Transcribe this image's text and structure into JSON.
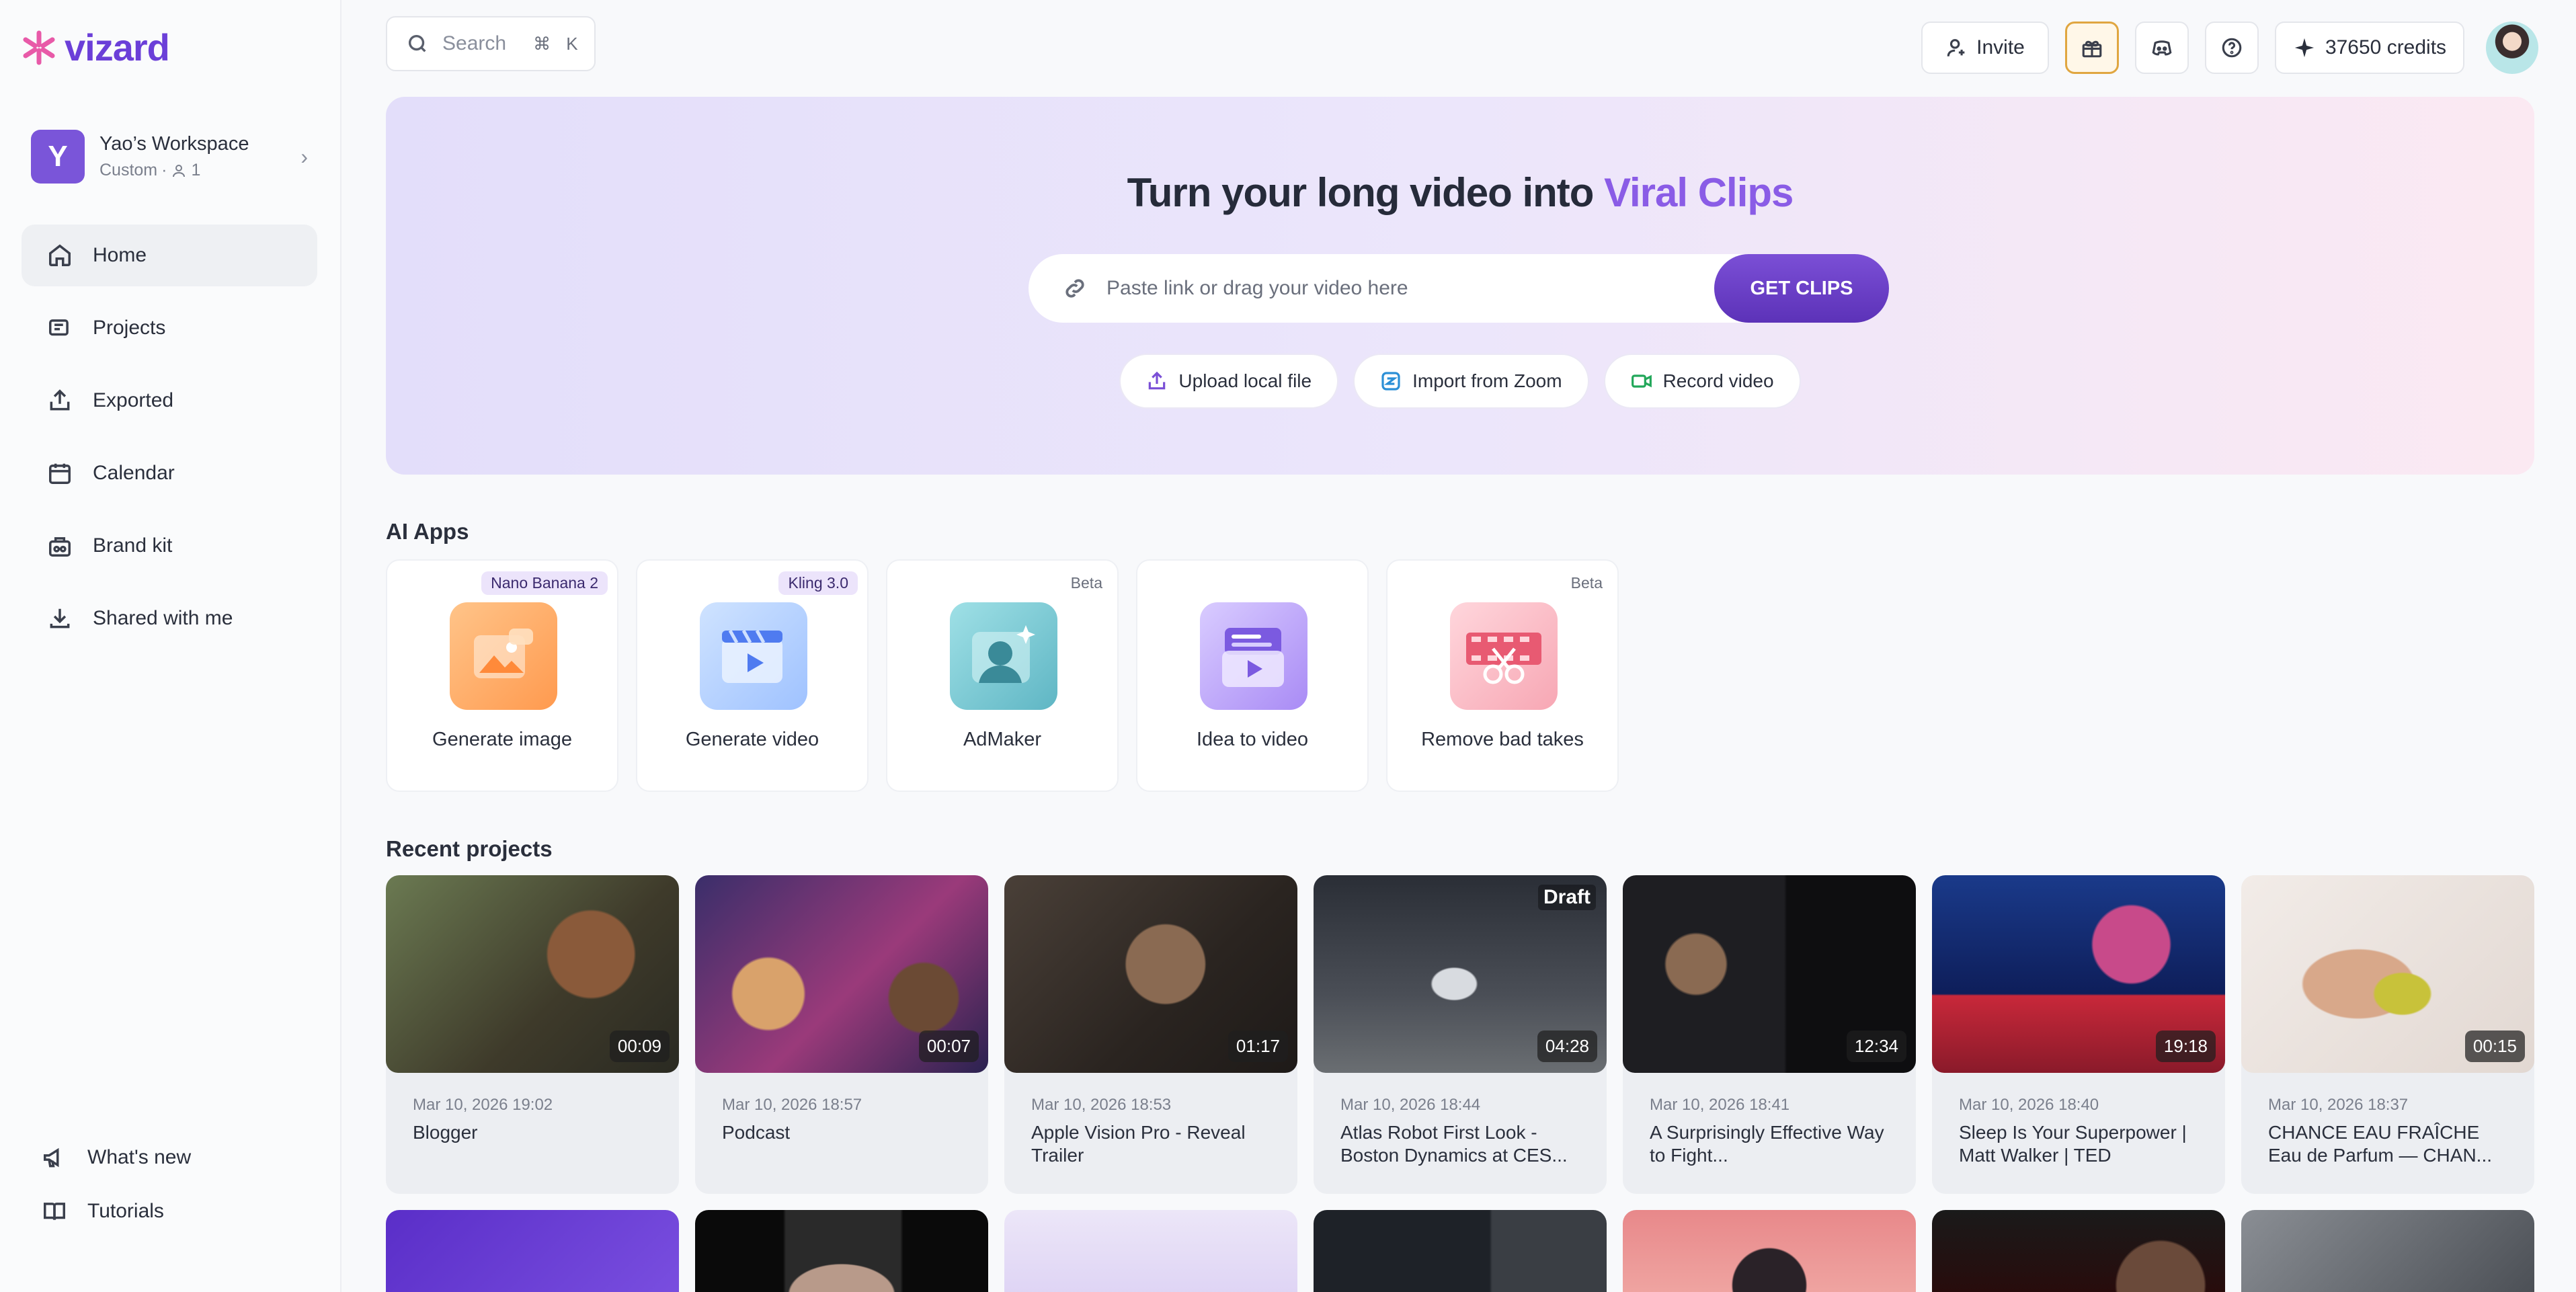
{
  "app": {
    "logo_text": "vizard"
  },
  "workspace": {
    "avatar_letter": "Y",
    "name": "Yao’s Workspace",
    "plan": "Custom",
    "members": "1"
  },
  "sidebar": {
    "items": [
      {
        "label": "Home",
        "icon": "home-icon",
        "active": true
      },
      {
        "label": "Projects",
        "icon": "projects-icon"
      },
      {
        "label": "Exported",
        "icon": "export-icon"
      },
      {
        "label": "Calendar",
        "icon": "calendar-icon"
      },
      {
        "label": "Brand kit",
        "icon": "brand-kit-icon"
      },
      {
        "label": "Shared with me",
        "icon": "shared-icon"
      }
    ],
    "bottom": [
      {
        "label": "What's new",
        "icon": "megaphone-icon"
      },
      {
        "label": "Tutorials",
        "icon": "book-icon"
      }
    ]
  },
  "topbar": {
    "search_placeholder": "Search",
    "search_shortcut": "⌘ K",
    "invite_label": "Invite",
    "credits_label": "37650 credits"
  },
  "hero": {
    "title_main": "Turn your long video into ",
    "title_accent": "Viral Clips",
    "input_placeholder": "Paste link or drag your video here",
    "cta_label": "GET CLIPS",
    "actions": [
      "Upload local file",
      "Import from Zoom",
      "Record video"
    ]
  },
  "ai_apps": {
    "title": "AI Apps",
    "items": [
      {
        "label": "Generate image",
        "tag": "Nano Banana 2"
      },
      {
        "label": "Generate video",
        "tag": "Kling 3.0"
      },
      {
        "label": "AdMaker",
        "tag": "Beta"
      },
      {
        "label": "Idea to video",
        "tag": ""
      },
      {
        "label": "Remove bad takes",
        "tag": "Beta"
      }
    ]
  },
  "recent": {
    "title": "Recent projects",
    "items": [
      {
        "date": "Mar 10, 2026 19:02",
        "title": "Blogger",
        "duration": "00:09"
      },
      {
        "date": "Mar 10, 2026 18:57",
        "title": "Podcast",
        "duration": "00:07"
      },
      {
        "date": "Mar 10, 2026 18:53",
        "title": "Apple Vision Pro - Reveal Trailer",
        "duration": "01:17"
      },
      {
        "date": "Mar 10, 2026 18:44",
        "title": "Atlas Robot First Look - Boston Dynamics at CES...",
        "duration": "04:28",
        "badge": "Draft"
      },
      {
        "date": "Mar 10, 2026 18:41",
        "title": "A Surprisingly Effective Way to Fight...",
        "duration": "12:34"
      },
      {
        "date": "Mar 10, 2026 18:40",
        "title": "Sleep Is Your Superpower | Matt Walker | TED",
        "duration": "19:18"
      },
      {
        "date": "Mar 10, 2026 18:37",
        "title": "CHANCE EAU FRAÎCHE Eau de Parfum — CHAN...",
        "duration": "00:15"
      }
    ]
  },
  "colors": {
    "brand": "#6b3fd8",
    "accent": "#8a5ce6",
    "cta": "#5c32b8"
  }
}
